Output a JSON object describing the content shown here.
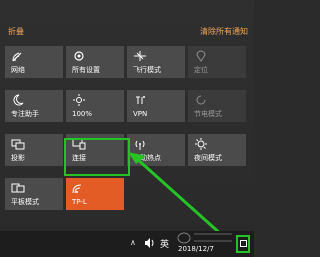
{
  "header": {
    "collapse_label": "折叠",
    "clear_label": "清除所有通知"
  },
  "tiles": [
    {
      "label": "网络",
      "icon": "network-icon",
      "state": "on"
    },
    {
      "label": "所有设置",
      "icon": "gear-icon",
      "state": "on"
    },
    {
      "label": "飞行模式",
      "icon": "airplane-icon",
      "state": "on"
    },
    {
      "label": "定位",
      "icon": "location-icon",
      "state": "off"
    },
    {
      "label": "专注助手",
      "icon": "moon-icon",
      "state": "on"
    },
    {
      "label": "100%",
      "icon": "brightness-icon",
      "state": "on"
    },
    {
      "label": "VPN",
      "icon": "vpn-icon",
      "state": "on"
    },
    {
      "label": "节电模式",
      "icon": "battery-saver-icon",
      "state": "off"
    },
    {
      "label": "投影",
      "icon": "project-icon",
      "state": "on"
    },
    {
      "label": "连接",
      "icon": "connect-icon",
      "state": "on"
    },
    {
      "label": "移动热点",
      "icon": "hotspot-icon",
      "state": "on"
    },
    {
      "label": "夜间模式",
      "icon": "night-light-icon",
      "state": "on"
    },
    {
      "label": "平板模式",
      "icon": "tablet-mode-icon",
      "state": "on"
    },
    {
      "label": "TP-L",
      "icon": "wifi-icon",
      "state": "accent"
    }
  ],
  "taskbar": {
    "chevron": "∧",
    "language": "英",
    "clock": "2018/12/7"
  },
  "colors": {
    "accent": "#e35c26",
    "header_text": "#f0a65b",
    "highlight": "#25c325"
  }
}
